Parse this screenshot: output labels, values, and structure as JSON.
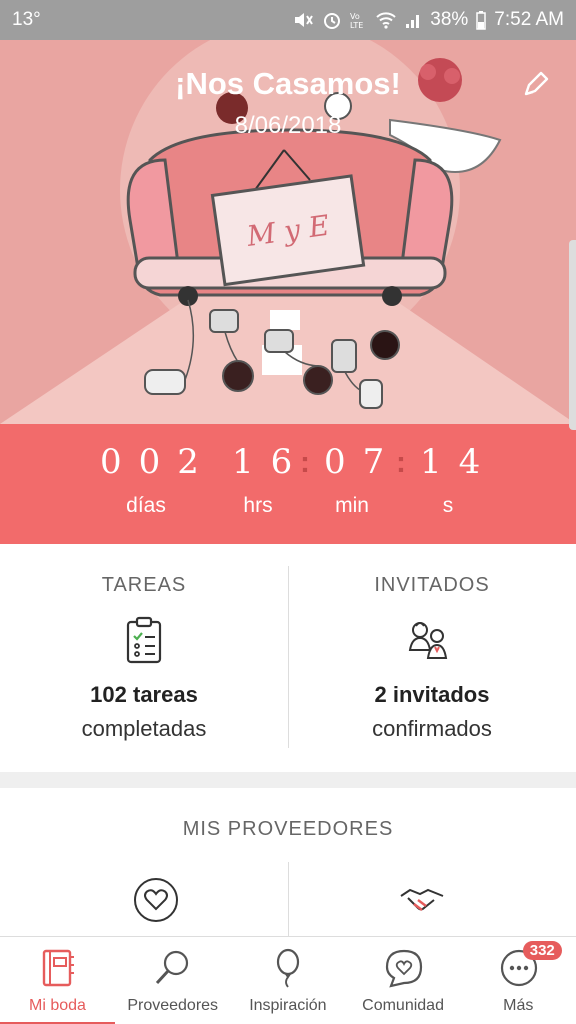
{
  "status_bar": {
    "left": "13°",
    "battery": "38%",
    "time": "7:52 AM"
  },
  "hero": {
    "title": "¡Nos Casamos!",
    "date": "8/06/2018",
    "sign_text": "M y E"
  },
  "countdown": {
    "days": "002",
    "hours": "16",
    "minutes": "07",
    "seconds": "14",
    "labels": {
      "days": "días",
      "hours": "hrs",
      "minutes": "min",
      "seconds": "s"
    }
  },
  "tasks": {
    "heading": "TAREAS",
    "count": "102 tareas",
    "sub": "completadas"
  },
  "guests": {
    "heading": "INVITADOS",
    "count": "2 invitados",
    "sub": "confirmados"
  },
  "providers": {
    "heading": "MIS PROVEEDORES"
  },
  "nav": {
    "items": [
      {
        "label": "Mi boda",
        "icon": "notebook-icon"
      },
      {
        "label": "Proveedores",
        "icon": "search-icon"
      },
      {
        "label": "Inspiración",
        "icon": "balloon-icon"
      },
      {
        "label": "Comunidad",
        "icon": "chat-heart-icon"
      },
      {
        "label": "Más",
        "icon": "more-icon",
        "badge": "332"
      }
    ]
  },
  "colors": {
    "accent": "#f26b6b",
    "hero_bg": "#e9a5a1",
    "nav_active": "#e65c5c"
  }
}
